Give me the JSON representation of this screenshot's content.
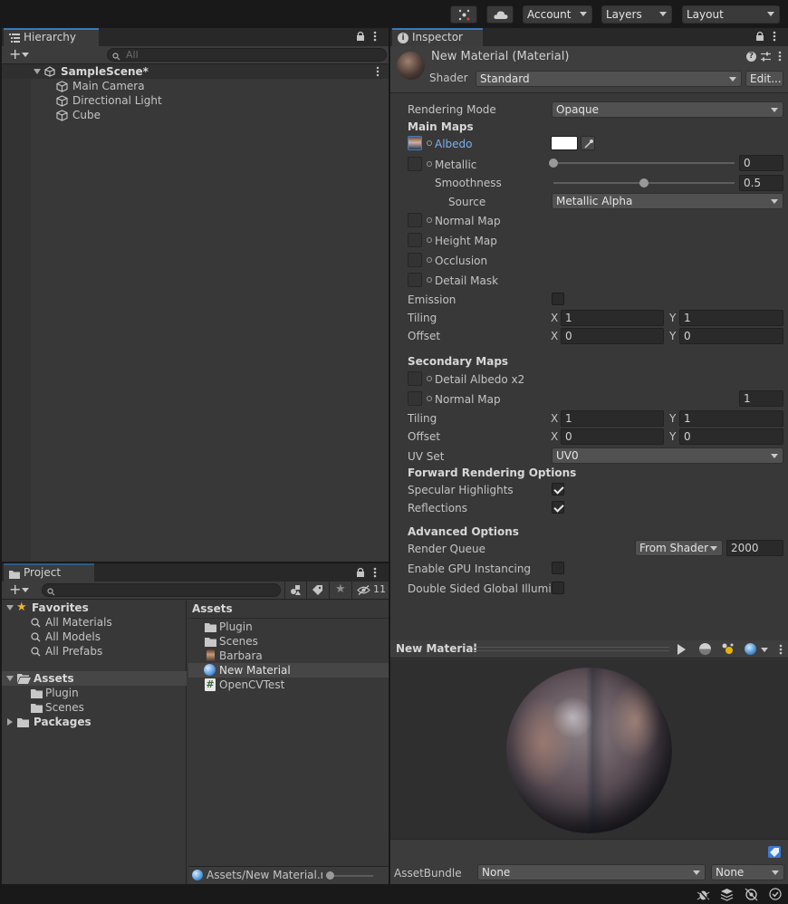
{
  "toolbar": {
    "account_label": "Account",
    "layers_label": "Layers",
    "layout_label": "Layout"
  },
  "hierarchy": {
    "tab_label": "Hierarchy",
    "search_placeholder": "All",
    "scene_name": "SampleScene*",
    "items": [
      "Main Camera",
      "Directional Light",
      "Cube"
    ]
  },
  "project": {
    "tab_label": "Project",
    "hidden_count": "11",
    "favorites_label": "Favorites",
    "favorites": [
      "All Materials",
      "All Models",
      "All Prefabs"
    ],
    "assets_label": "Assets",
    "asset_folders": [
      "Plugin",
      "Scenes"
    ],
    "packages_label": "Packages",
    "assets_header": "Assets",
    "files": [
      "Plugin",
      "Scenes",
      "Barbara",
      "New Material",
      "OpenCVTest"
    ],
    "status_path": "Assets/New Material.m"
  },
  "inspector": {
    "tab_label": "Inspector",
    "material_title": "New Material (Material)",
    "shader_label": "Shader",
    "shader_value": "Standard",
    "edit_label": "Edit...",
    "rendering_mode_label": "Rendering Mode",
    "rendering_mode_value": "Opaque",
    "main_maps_label": "Main Maps",
    "albedo_label": "Albedo",
    "metallic_label": "Metallic",
    "metallic_value": "0",
    "metallic_level": 0,
    "smoothness_label": "Smoothness",
    "smoothness_value": "0.5",
    "smoothness_level": 0.5,
    "source_label": "Source",
    "source_value": "Metallic Alpha",
    "normal_map_label": "Normal Map",
    "height_map_label": "Height Map",
    "occlusion_label": "Occlusion",
    "detail_mask_label": "Detail Mask",
    "emission_label": "Emission",
    "tiling_label": "Tiling",
    "offset_label": "Offset",
    "x_label": "X",
    "y_label": "Y",
    "main_tiling_x": "1",
    "main_tiling_y": "1",
    "main_offset_x": "0",
    "main_offset_y": "0",
    "secondary_maps_label": "Secondary Maps",
    "detail_albedo_label": "Detail Albedo x2",
    "sec_normal_map_label": "Normal Map",
    "sec_normal_value": "1",
    "sec_tiling_x": "1",
    "sec_tiling_y": "1",
    "sec_offset_x": "0",
    "sec_offset_y": "0",
    "uv_set_label": "UV Set",
    "uv_set_value": "UV0",
    "forward_label": "Forward Rendering Options",
    "specular_label": "Specular Highlights",
    "reflections_label": "Reflections",
    "advanced_label": "Advanced Options",
    "render_queue_label": "Render Queue",
    "render_queue_mode": "From Shader",
    "render_queue_value": "2000",
    "gpu_instancing_label": "Enable GPU Instancing",
    "double_sided_label": "Double Sided Global Illumina"
  },
  "preview": {
    "title": "New Material"
  },
  "assetbundle": {
    "label": "AssetBundle",
    "name_value": "None",
    "variant_value": "None"
  },
  "colors": {
    "accent": "#3a79bb",
    "albedo_link": "#7cb1ee",
    "panel_bg": "#383838"
  }
}
